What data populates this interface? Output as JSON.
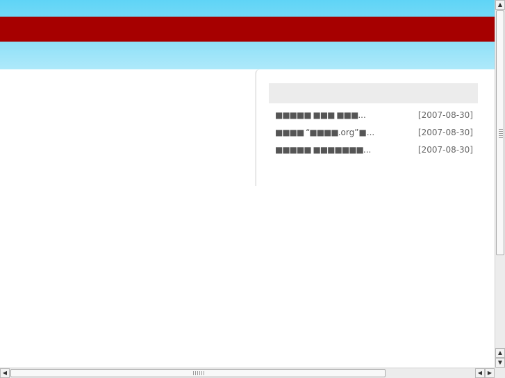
{
  "news": {
    "items": [
      {
        "title_block": "■■■■■ ■■■ ■■■",
        "title_tail": "...",
        "date": "[2007-08-30]"
      },
      {
        "title_block": "■■■■ “■■■■",
        "title_tail": ".org”■...",
        "date": "[2007-08-30]"
      },
      {
        "title_block": "■■■■■ ■■■■■■■",
        "title_tail": "...",
        "date": "[2007-08-30]"
      }
    ]
  },
  "scrollbars": {
    "vertical": {
      "up_arrow": "▲",
      "down_arrow": "▼"
    },
    "horizontal": {
      "left_arrow": "◀",
      "right_arrow": "▶"
    }
  },
  "colors": {
    "header_gradient_top": "#5fd4f6",
    "header_red": "#a60000"
  }
}
